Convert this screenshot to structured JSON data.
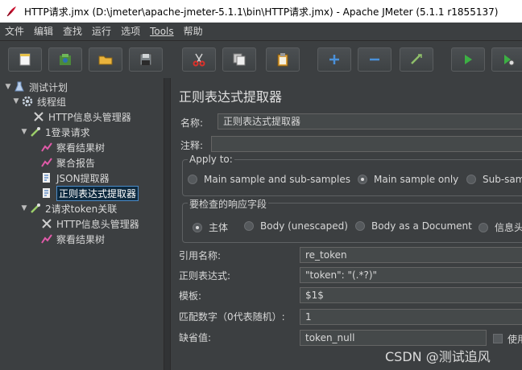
{
  "window": {
    "title": "HTTP请求.jmx (D:\\jmeter\\apache-jmeter-5.1.1\\bin\\HTTP请求.jmx) - Apache JMeter (5.1.1 r1855137)"
  },
  "menu": [
    "文件",
    "编辑",
    "查找",
    "运行",
    "选项",
    "Tools",
    "帮助"
  ],
  "toolbar": {
    "icons": [
      "new-icon",
      "templates-icon",
      "open-icon",
      "save-icon",
      "cut-icon",
      "copy-icon",
      "paste-icon",
      "expand-icon",
      "collapse-icon",
      "toggle-icon",
      "start-icon",
      "start-no-pause-icon"
    ]
  },
  "tree": [
    {
      "label": "测试计划",
      "icon": "test-plan-icon",
      "toggle": "▼"
    },
    {
      "label": "线程组",
      "icon": "thread-group-icon",
      "toggle": "▼"
    },
    {
      "label": "HTTP信息头管理器",
      "icon": "header-manager-icon",
      "toggle": ""
    },
    {
      "label": "1登录请求",
      "icon": "http-sampler-icon",
      "toggle": "▼"
    },
    {
      "label": "察看结果树",
      "icon": "listener-icon",
      "toggle": ""
    },
    {
      "label": "聚合报告",
      "icon": "listener-icon",
      "toggle": ""
    },
    {
      "label": "JSON提取器",
      "icon": "extractor-icon",
      "toggle": ""
    },
    {
      "label": "正则表达式提取器",
      "icon": "extractor-icon",
      "toggle": ""
    },
    {
      "label": "2请求token关联",
      "icon": "http-sampler-icon",
      "toggle": "▼"
    },
    {
      "label": "HTTP信息头管理器",
      "icon": "header-manager-icon",
      "toggle": ""
    },
    {
      "label": "察看结果树",
      "icon": "listener-icon",
      "toggle": ""
    }
  ],
  "panel": {
    "title": "正则表达式提取器",
    "name_label": "名称:",
    "name_value": "正则表达式提取器",
    "comment_label": "注释:",
    "apply_to": {
      "title": "Apply to:",
      "options": [
        "Main sample and sub-samples",
        "Main sample only",
        "Sub-sam"
      ],
      "selected": 1
    },
    "field_check": {
      "title": "要检查的响应字段",
      "options": [
        "主体",
        "Body (unescaped)",
        "Body as a Document",
        "信息头"
      ],
      "selected": 0
    },
    "ref_name_label": "引用名称:",
    "ref_name_value": "re_token",
    "regex_label": "正则表达式:",
    "regex_value": "\"token\": \"(.*?)\"",
    "template_label": "模板:",
    "template_value": "$1$",
    "match_no_label": "匹配数字（0代表随机）:",
    "match_no_value": "1",
    "default_label": "缺省值:",
    "default_value": "token_null",
    "use_empty_label": "使用"
  },
  "watermark": "CSDN @测试追风",
  "colors": {
    "bg": "#3c3f41",
    "field": "#45494a",
    "selection": "#0d293e",
    "run_green": "#3cb043"
  }
}
